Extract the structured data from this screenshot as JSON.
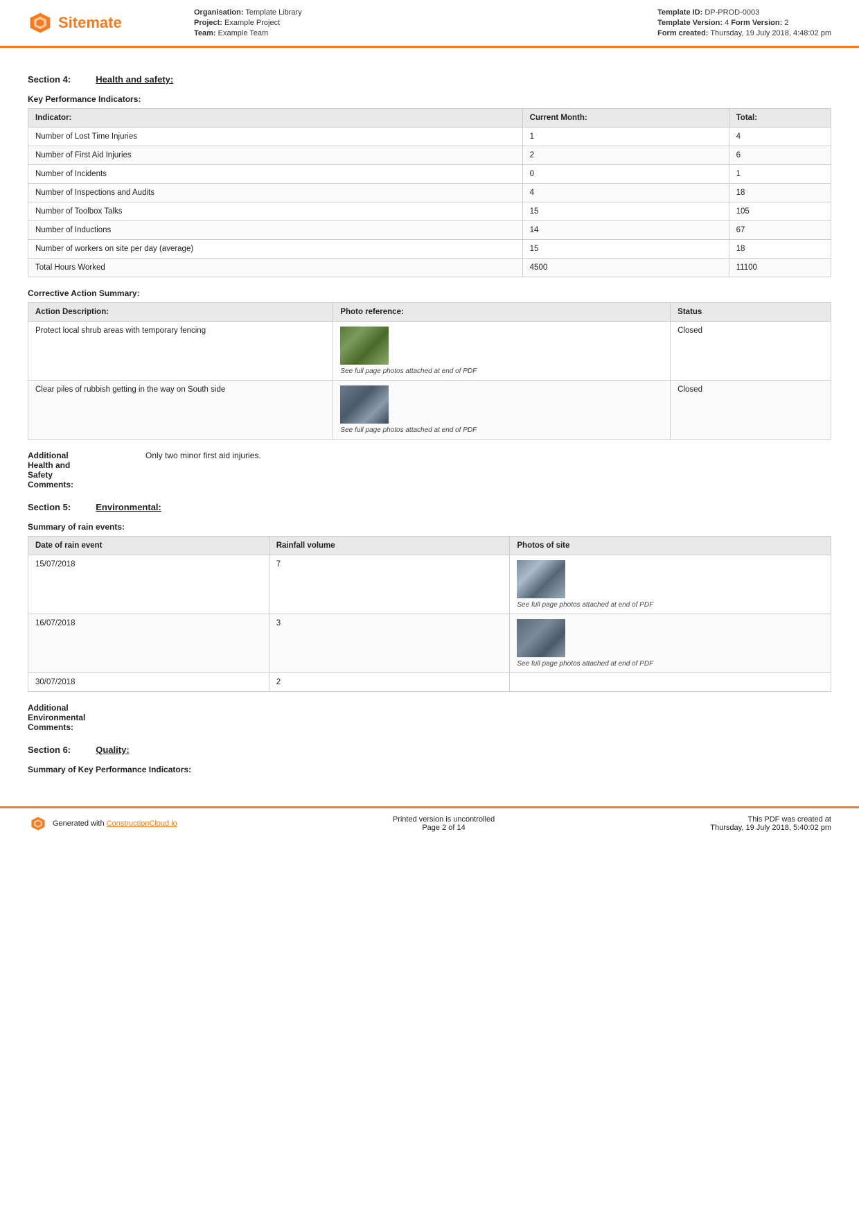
{
  "header": {
    "logo_text": "Sitemate",
    "org_label": "Organisation:",
    "org_value": "Template Library",
    "project_label": "Project:",
    "project_value": "Example Project",
    "team_label": "Team:",
    "team_value": "Example Team",
    "template_id_label": "Template ID:",
    "template_id_value": "DP-PROD-0003",
    "template_version_label": "Template Version:",
    "template_version_value": "4",
    "form_version_label": "Form Version:",
    "form_version_value": "2",
    "form_created_label": "Form created:",
    "form_created_value": "Thursday, 19 July 2018, 4:48:02 pm"
  },
  "section4": {
    "label": "Section 4:",
    "title": "Health and safety:"
  },
  "kpi": {
    "title": "Key Performance Indicators:",
    "columns": [
      "Indicator:",
      "Current Month:",
      "Total:"
    ],
    "rows": [
      [
        "Number of Lost Time Injuries",
        "1",
        "4"
      ],
      [
        "Number of First Aid Injuries",
        "2",
        "6"
      ],
      [
        "Number of Incidents",
        "0",
        "1"
      ],
      [
        "Number of Inspections and Audits",
        "4",
        "18"
      ],
      [
        "Number of Toolbox Talks",
        "15",
        "105"
      ],
      [
        "Number of Inductions",
        "14",
        "67"
      ],
      [
        "Number of workers on site per day (average)",
        "15",
        "18"
      ],
      [
        "Total Hours Worked",
        "4500",
        "11100"
      ]
    ]
  },
  "corrective": {
    "title": "Corrective Action Summary:",
    "columns": [
      "Action Description:",
      "Photo reference:",
      "Status"
    ],
    "rows": [
      {
        "action": "Protect local shrub areas with temporary fencing",
        "photo_class": "photo-shrub",
        "photo_caption": "See full page photos attached at end of PDF",
        "status": "Closed"
      },
      {
        "action": "Clear piles of rubbish getting in the way on South side",
        "photo_class": "photo-rubbish",
        "photo_caption": "See full page photos attached at end of PDF",
        "status": "Closed"
      }
    ]
  },
  "additional_hs": {
    "label": "Additional\nHealth and\nSafety\nComments:",
    "label_lines": [
      "Additional",
      "Health and",
      "Safety",
      "Comments:"
    ],
    "value": "Only two minor first aid injuries."
  },
  "section5": {
    "label": "Section 5:",
    "title": "Environmental:"
  },
  "rain": {
    "title": "Summary of rain events:",
    "columns": [
      "Date of rain event",
      "Rainfall volume",
      "Photos of site"
    ],
    "rows": [
      {
        "date": "15/07/2018",
        "volume": "7",
        "photo_class": "photo-rain1",
        "photo_caption": "See full page photos attached at end of PDF"
      },
      {
        "date": "16/07/2018",
        "volume": "3",
        "photo_class": "photo-rain2",
        "photo_caption": "See full page photos attached at end of PDF"
      },
      {
        "date": "30/07/2018",
        "volume": "2",
        "photo_class": "",
        "photo_caption": ""
      }
    ]
  },
  "additional_env": {
    "label_lines": [
      "Additional",
      "Environmental",
      "Comments:"
    ],
    "value": ""
  },
  "section6": {
    "label": "Section 6:",
    "title": "Quality:"
  },
  "summary_kpi": {
    "title": "Summary of Key Performance Indicators:"
  },
  "footer": {
    "generated_text": "Generated with ",
    "link_text": "ConstructionCloud.io",
    "center_line1": "Printed version is uncontrolled",
    "center_line2": "Page 2 of 14",
    "right_line1": "This PDF was created at",
    "right_line2": "Thursday, 19 July 2018, 5:40:02 pm"
  }
}
